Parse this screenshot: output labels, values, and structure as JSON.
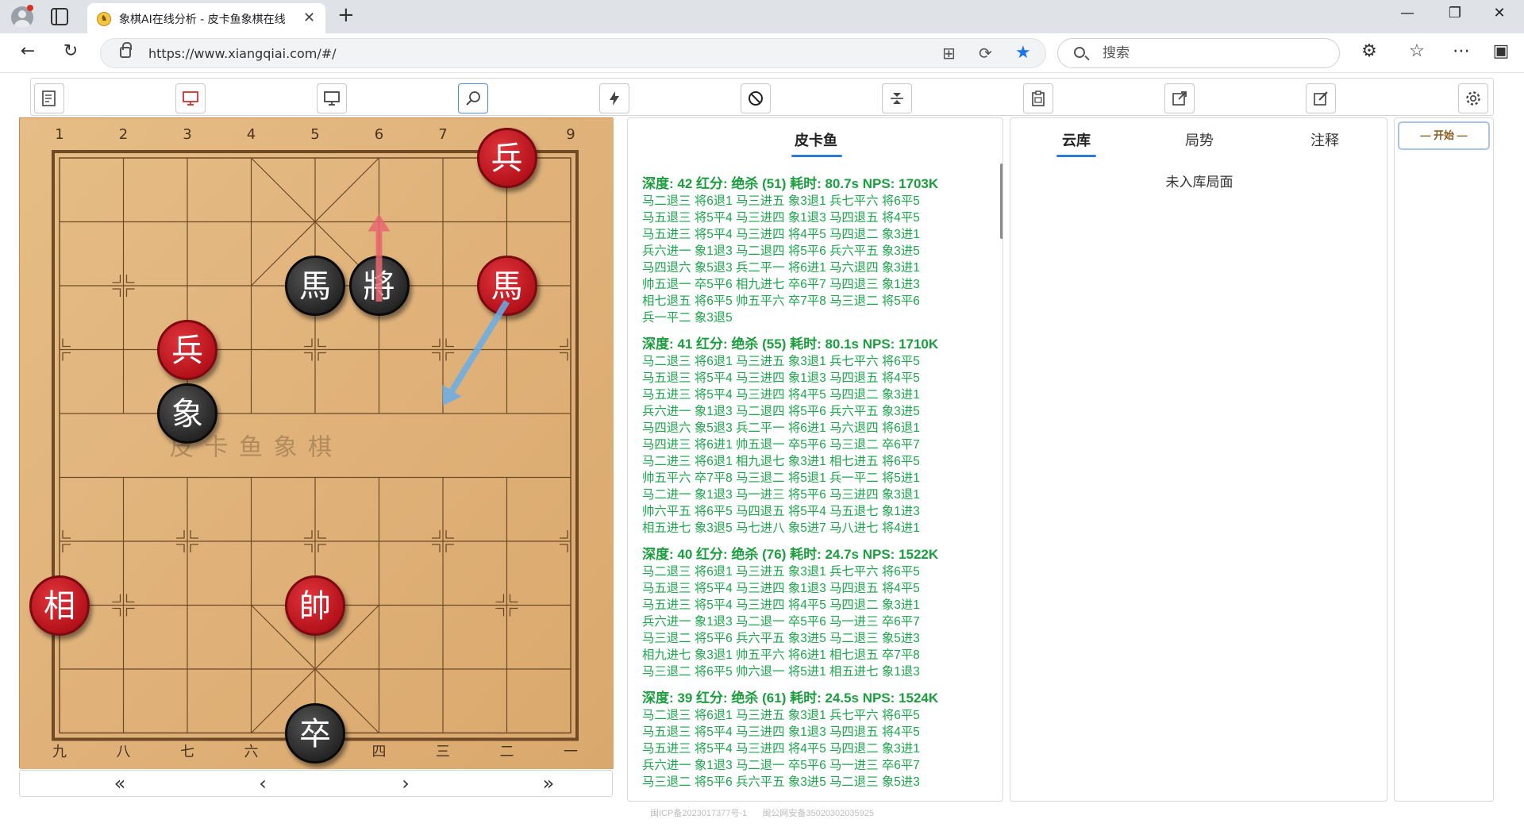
{
  "browser": {
    "tab_title": "象棋AI在线分析 - 皮卡鱼象棋在线",
    "url": "https://www.xiangqiai.com/#/",
    "search_placeholder": "搜索"
  },
  "board": {
    "watermark": "皮 卡 鱼 象 棋",
    "top_files": [
      "1",
      "2",
      "3",
      "4",
      "5",
      "6",
      "7",
      "8",
      "9"
    ],
    "bottom_files": [
      "九",
      "八",
      "七",
      "六",
      "五",
      "四",
      "三",
      "二",
      "一"
    ],
    "pieces": [
      {
        "char": "兵",
        "color": "red",
        "file": 7,
        "rank": 0
      },
      {
        "char": "馬",
        "color": "black",
        "file": 4,
        "rank": 2
      },
      {
        "char": "將",
        "color": "black",
        "file": 5,
        "rank": 2
      },
      {
        "char": "馬",
        "color": "red",
        "file": 7,
        "rank": 2
      },
      {
        "char": "兵",
        "color": "red",
        "file": 2,
        "rank": 3
      },
      {
        "char": "象",
        "color": "black",
        "file": 2,
        "rank": 4
      },
      {
        "char": "相",
        "color": "red",
        "file": 0,
        "rank": 7
      },
      {
        "char": "帥",
        "color": "red",
        "file": 4,
        "rank": 7
      },
      {
        "char": "卒",
        "color": "black",
        "file": 4,
        "rank": 9
      }
    ],
    "arrows": [
      {
        "from_file": 5,
        "from_rank": 2,
        "to_file": 5,
        "to_rank": 1,
        "color": "#e8666e"
      },
      {
        "from_file": 7,
        "from_rank": 2,
        "to_file": 6,
        "to_rank": 4,
        "color": "#6aaee8"
      }
    ],
    "colors": {
      "wood": "#e2b57c",
      "line": "#6e4a26",
      "red_piece": "#b5121b",
      "black_piece": "#262626"
    }
  },
  "analysis": {
    "title": "皮卡鱼",
    "blocks": [
      {
        "head": "深度: 42 红分: 绝杀 (51) 耗时: 80.7s NPS: 1703K",
        "lines": [
          "马二退三 将6退1 马三进五 象3退1 兵七平六 将6平5",
          "马五退三 将5平4 马三进四 象1退3 马四退五 将4平5",
          "马五进三 将5平4 马三进四 将4平5 马四退二 象3进1",
          "兵六进一 象1退3 马二退四 将5平6 兵六平五 象3进5",
          "马四退六 象5退3 兵二平一 将6进1 马六退四 象3进1",
          "帅五退一 卒5平6 相九进七 卒6平7 马四退三 象1进3",
          "相七退五 将6平5 帅五平六 卒7平8 马三退二 将5平6",
          "兵一平二 象3退5"
        ]
      },
      {
        "head": "深度: 41 红分: 绝杀 (55) 耗时: 80.1s NPS: 1710K",
        "lines": [
          "马二退三 将6退1 马三进五 象3退1 兵七平六 将6平5",
          "马五退三 将5平4 马三进四 象1退3 马四退五 将4平5",
          "马五进三 将5平4 马三进四 将4平5 马四退二 象3进1",
          "兵六进一 象1退3 马二退四 将5平6 兵六平五 象3进5",
          "马四退六 象5退3 兵二平一 将6进1 马六退四 将6退1",
          "马四进三 将6进1 帅五退一 卒5平6 马三退二 卒6平7",
          "马二进三 将6退1 相九退七 象3进1 相七进五 将6平5",
          "帅五平六 卒7平8 马三退二 将5退1 兵一平二 将5进1",
          "马二进一 象1退3 马一进三 将5平6 马三进四 象3退1",
          "帅六平五 将6平5 马四退五 将5平4 马五退七 象1进3",
          "相五进七 象3退5 马七进八 象5进7 马八进七 将4进1"
        ]
      },
      {
        "head": "深度: 40 红分: 绝杀 (76) 耗时: 24.7s NPS: 1522K",
        "lines": [
          "马二退三 将6退1 马三进五 象3退1 兵七平六 将6平5",
          "马五退三 将5平4 马三进四 象1退3 马四退五 将4平5",
          "马五进三 将5平4 马三进四 将4平5 马四退二 象3进1",
          "兵六进一 象1退3 马二退一 卒5平6 马一进三 卒6平7",
          "马三退二 将5平6 兵六平五 象3进5 马二退三 象5进3",
          "相九进七 象3退1 帅五平六 将6进1 相七退五 卒7平8",
          "马三退二 将6平5 帅六退一 将5进1 相五进七 象1退3"
        ]
      },
      {
        "head": "深度: 39 红分: 绝杀 (61) 耗时: 24.5s NPS: 1524K",
        "lines": [
          "马二退三 将6退1 马三进五 象3退1 兵七平六 将6平5",
          "马五退三 将5平4 马三进四 象1退3 马四退五 将4平5",
          "马五进三 将5平4 马三进四 将4平5 马四退二 象3进1",
          "兵六进一 象1退3 马二退一 卒5平6 马一进三 卒6平7",
          "马三退二 将5平6 兵六平五 象3进5 马二退三 象5进3"
        ]
      }
    ]
  },
  "cloud": {
    "tabs": [
      "云库",
      "局势",
      "注释"
    ],
    "message": "未入库局面"
  },
  "moves": {
    "start_label": "— 开始 —"
  },
  "footer": {
    "icp": "闽ICP备2023017377号-1",
    "police": "闽公网安备35020302035925"
  }
}
